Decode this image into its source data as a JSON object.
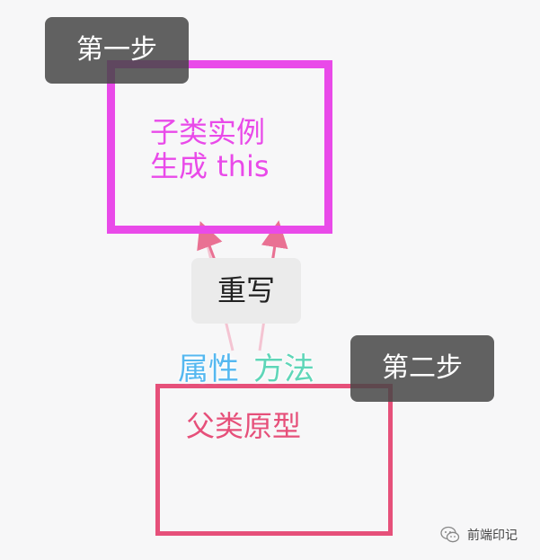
{
  "diagram": {
    "child_box": {
      "line1": "子类实例",
      "line2": "生成 this",
      "color": "#e94ae9"
    },
    "parent_box": {
      "label": "父类原型",
      "color": "#e6507a"
    },
    "step1": "第一步",
    "step2": "第二步",
    "override": "重写",
    "property": "属性",
    "method": "方法",
    "arrow_color": "#e6507a",
    "property_color": "#55b8f0",
    "method_color": "#5fd6b8"
  },
  "footer": {
    "icon": "wechat-icon",
    "text": "前端印记"
  }
}
